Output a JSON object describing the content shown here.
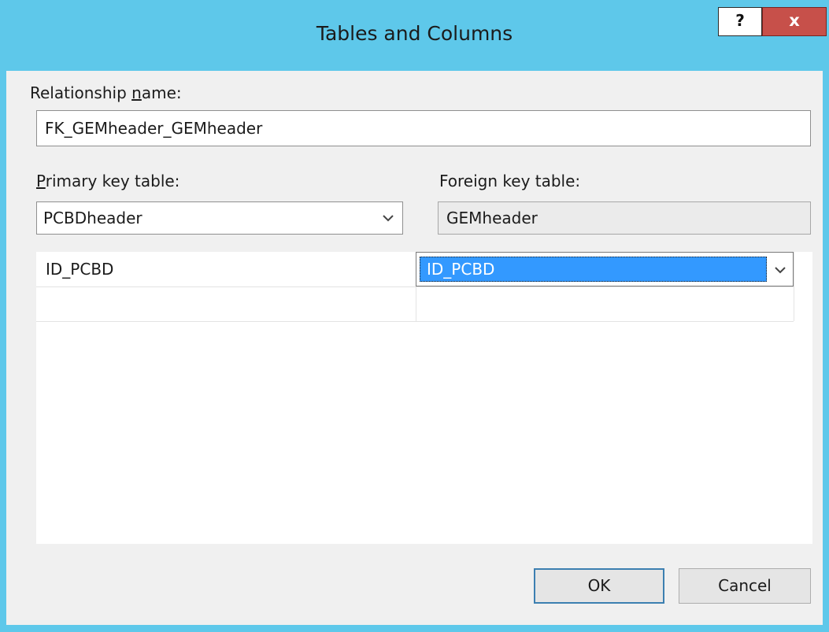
{
  "window": {
    "title": "Tables and Columns",
    "help_label": "?",
    "close_label": "x"
  },
  "relationship": {
    "label_prefix": "Relationship ",
    "label_mnemonic": "n",
    "label_suffix": "ame:",
    "value": "FK_GEMheader_GEMheader"
  },
  "primary_key": {
    "label_mnemonic": "P",
    "label_suffix": "rimary key table:",
    "selected": "PCBDheader"
  },
  "foreign_key": {
    "label": "Foreign key table:",
    "value": "GEMheader"
  },
  "column_grid": {
    "rows": [
      {
        "primary": "ID_PCBD",
        "foreign": "ID_PCBD"
      },
      {
        "primary": "",
        "foreign": ""
      }
    ]
  },
  "buttons": {
    "ok": "OK",
    "cancel": "Cancel"
  },
  "colors": {
    "titlebar": "#5ec8ea",
    "close_button": "#c7504a",
    "selection": "#3399ff"
  }
}
